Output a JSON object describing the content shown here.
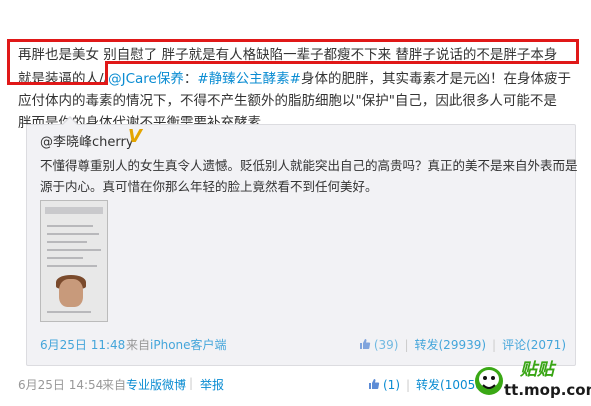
{
  "post": {
    "line1": "再胖也是美女 别自慰了 胖子就是有人格缺陷一辈子都瘦不下来 替胖子说话的不是胖子本身",
    "line2_prefix": "就是装逼的人",
    "line2_mention_slash": "//",
    "line2_mention": "@JCare保养",
    "line2_colon": "：",
    "line2_tag": "#静臻公主酵素#",
    "line2_rest": "身体的肥胖，其实毒素才是元凶！在身体疲于",
    "line3": "应付体内的毒素的情况下，不得不产生额外的脂肪细胞以\"保护\"自己，因此很多人可能不是",
    "line4": "胖而是你的身体代谢不平衡需要补充酵素"
  },
  "repost": {
    "author": "@李晓峰cherry",
    "verified_badge": "V",
    "text_line1": "不懂得尊重别人的女生真令人遗憾。贬低别人就能突出自己的高贵吗？真正的美不是来自外表而是",
    "text_line2": "源于内心。真可惜在你那么年轻的脸上竟然看不到任何美好。",
    "time": "6月25日 11:48",
    "from_label": "来自",
    "client": "iPhone客户端",
    "likes": "(39)",
    "reposts": "转发(29939)",
    "comments": "评论(2071)"
  },
  "footer": {
    "time": "6月25日 14:54",
    "from_label": "来自",
    "client": "专业版微博",
    "report": "举报",
    "likes": "(1)",
    "reposts": "转发(10058)"
  },
  "watermark": {
    "logo": "贴贴",
    "site": "tt.mop.com"
  },
  "colors": {
    "link": "#0a8cd2",
    "highlight_box": "#e01818",
    "watermark_green": "#38a513"
  }
}
